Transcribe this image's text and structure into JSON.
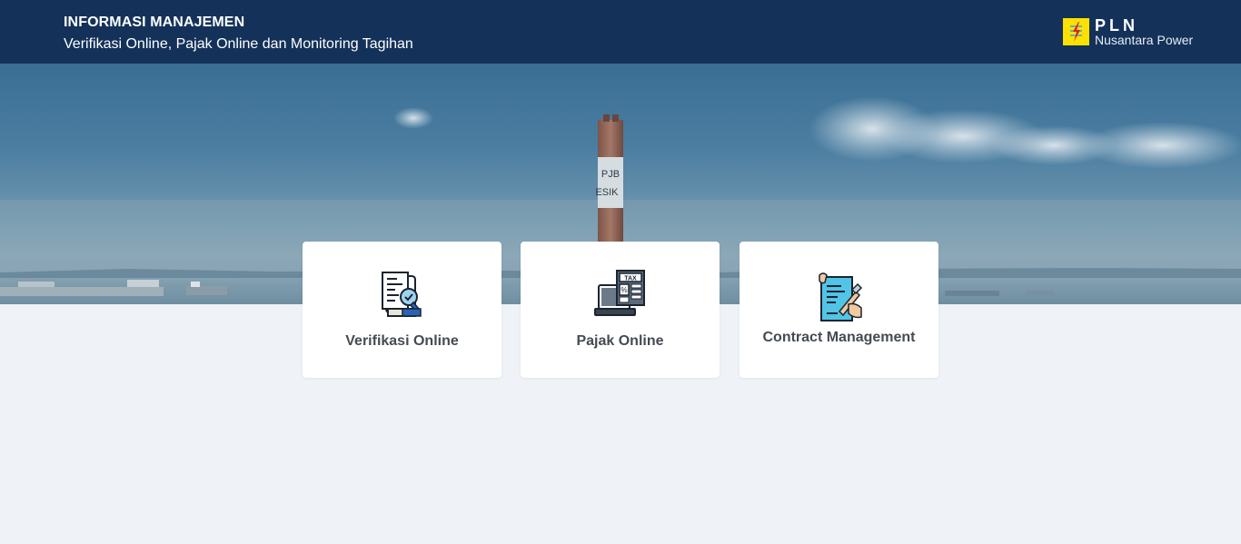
{
  "header": {
    "title": "INFORMASI MANAJEMEN",
    "subtitle": "Verifikasi Online, Pajak Online dan Monitoring Tagihan"
  },
  "brand": {
    "name": "PLN",
    "subname": "Nusantara Power",
    "icon": "pln-lightning-logo",
    "color_yellow": "#ffe100"
  },
  "hero": {
    "chimney_text_top": "PJB",
    "chimney_text_bottom": "ESIK"
  },
  "menu": {
    "items": [
      {
        "label": "Verifikasi Online",
        "icon": "document-verify-icon"
      },
      {
        "label": "Pajak Online",
        "icon": "tax-calculator-icon"
      },
      {
        "label": "Contract Management",
        "icon": "contract-sign-icon"
      }
    ]
  },
  "colors": {
    "header_bg": "#143259",
    "page_bg": "#eff2f6",
    "card_bg": "#ffffff",
    "label_text": "#454b52"
  }
}
